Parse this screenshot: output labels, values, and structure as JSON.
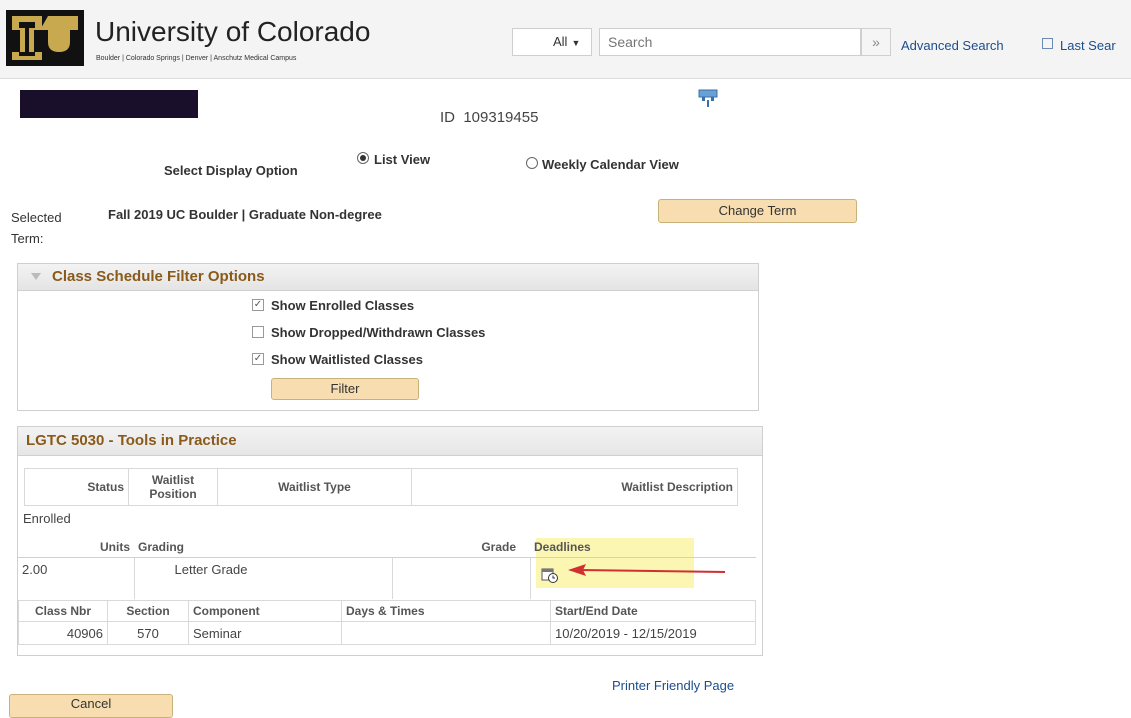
{
  "header": {
    "university_name": "University of Colorado",
    "campuses": "Boulder | Colorado Springs | Denver | Anschutz Medical Campus",
    "search_scope": "All",
    "search_placeholder": "Search",
    "advanced_search": "Advanced Search",
    "last_search": "Last Sear"
  },
  "student": {
    "id_label": "ID",
    "id_value": "109319455"
  },
  "display_option": {
    "label": "Select Display Option",
    "list_view": "List View",
    "weekly_view": "Weekly Calendar View",
    "selected": "List View"
  },
  "term": {
    "label": "Selected Term:",
    "value": "Fall 2019 UC Boulder | Graduate Non-degree",
    "change_button": "Change Term"
  },
  "filter": {
    "title": "Class Schedule Filter Options",
    "options": [
      {
        "label": "Show Enrolled Classes",
        "checked": true
      },
      {
        "label": "Show Dropped/Withdrawn Classes",
        "checked": false
      },
      {
        "label": "Show Waitlisted Classes",
        "checked": true
      }
    ],
    "button": "Filter"
  },
  "class": {
    "title": "LGTC 5030 - Tools in Practice",
    "status_headers": [
      "Status",
      "Waitlist Position",
      "Waitlist Type",
      "Waitlist Description"
    ],
    "status_value": "Enrolled",
    "unit_headers": [
      "Units",
      "Grading",
      "Grade",
      "Deadlines"
    ],
    "units": "2.00",
    "grading": "Letter Grade",
    "grade": "",
    "deadline_icon": "calendar-clock-icon",
    "meeting_headers": [
      "Class Nbr",
      "Section",
      "Component",
      "Days & Times",
      "Start/End Date"
    ],
    "meeting": {
      "class_nbr": "40906",
      "section": "570",
      "component": "Seminar",
      "days_times": "",
      "dates": "10/20/2019 - 12/15/2019"
    }
  },
  "footer": {
    "printer_friendly": "Printer Friendly Page",
    "cancel": "Cancel"
  },
  "colors": {
    "accent_title": "#8a5a1a",
    "button_bg": "#f7ddb0",
    "link": "#1c4d8c",
    "highlight": "#fbf39a",
    "arrow": "#d03030"
  }
}
